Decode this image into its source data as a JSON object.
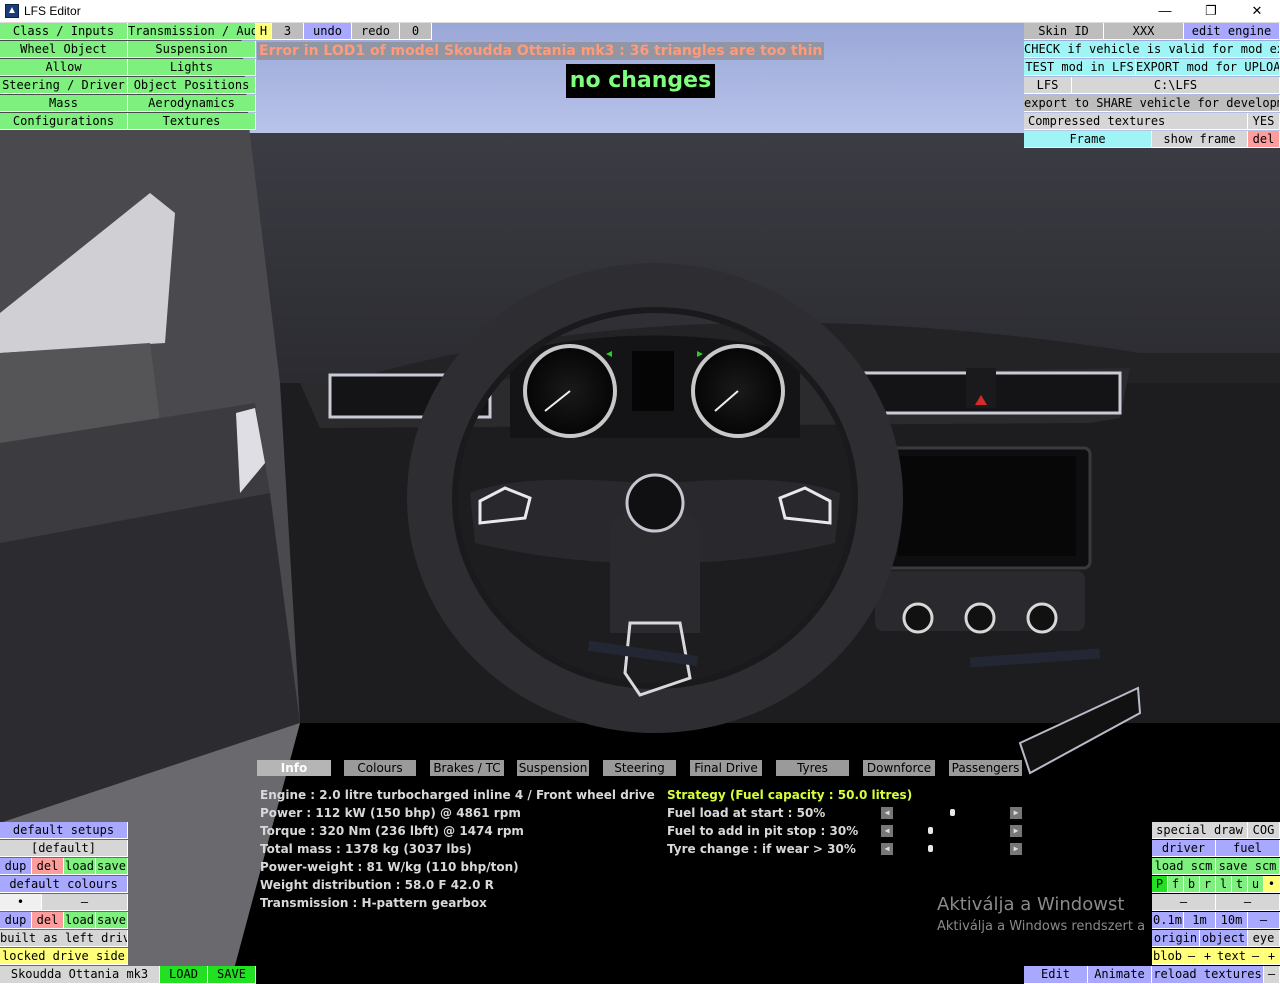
{
  "window": {
    "title": "LFS Editor",
    "minimize": "—",
    "maximize": "❐",
    "close": "✕"
  },
  "left_menu": {
    "col1": [
      "Class / Inputs",
      "Wheel Object",
      "Allow",
      "Steering / Driver",
      "Mass",
      "Configurations"
    ],
    "col2": [
      "Transmission / Audio",
      "Suspension",
      "Lights",
      "Object Positions",
      "Aerodynamics",
      "Textures"
    ]
  },
  "toolbar": {
    "h": "H",
    "count": "3",
    "undo": "undo",
    "redo": "redo",
    "redo_count": "0"
  },
  "messages": {
    "error": "Error in LOD1 of model Skoudda Ottania mk3 : 36 triangles are too thin",
    "status": "no changes"
  },
  "right_panel": {
    "skin_id": "Skin ID",
    "skin_value": "XXX",
    "edit_engine": "edit engine",
    "check": "CHECK if vehicle is valid for mod export",
    "test": "TEST mod in LFS",
    "export_upload": "EXPORT mod for UPLOAD",
    "lfs": "LFS",
    "path": "C:\\LFS",
    "export_share": "export to SHARE vehicle for development",
    "compressed": "Compressed textures",
    "compressed_value": "YES",
    "frame": "Frame",
    "show_frame": "show frame",
    "del": "del"
  },
  "tabs": [
    "Info",
    "Colours",
    "Brakes / TC",
    "Suspension",
    "Steering",
    "Final Drive",
    "Tyres",
    "Downforce",
    "Passengers"
  ],
  "info": {
    "engine": "Engine : 2.0 litre turbocharged inline 4 / Front wheel drive",
    "power": "Power : 112 kW (150 bhp) @ 4861 rpm",
    "torque": "Torque : 320 Nm (236 lbft) @ 1474 rpm",
    "mass": "Total mass : 1378 kg (3037 lbs)",
    "power_weight": "Power-weight : 81 W/kg (110 bhp/ton)",
    "weight_dist": "Weight distribution : 58.0 F  42.0 R",
    "transmission": "Transmission : H-pattern gearbox"
  },
  "strategy": {
    "title": "Strategy (Fuel capacity : 50.0 litres)",
    "fuel_load": "Fuel load at start : 50%",
    "fuel_pit": "Fuel to add in pit stop : 30%",
    "tyre_change": "Tyre change : if wear > 30%",
    "fuel_load_level": 0.5,
    "fuel_pit_level": 0.3,
    "tyre_change_level": 0.3
  },
  "bottom_left": {
    "default_setups": "default setups",
    "default": "[default]",
    "dup": "dup",
    "del": "del",
    "load": "load",
    "save": "save",
    "default_colours": "default colours",
    "dot": "•",
    "dash": "–",
    "built_left": "built as left drive",
    "locked": "locked drive side",
    "car_name": "Skoudda Ottania mk3",
    "load_btn": "LOAD",
    "save_btn": "SAVE"
  },
  "bottom_right": {
    "special_draw": "special draw",
    "cog": "COG",
    "driver": "driver",
    "fuel": "fuel",
    "load_scm": "load scm",
    "save_scm": "save scm",
    "letters": [
      "P",
      "f",
      "b",
      "r",
      "l",
      "t",
      "u",
      "•"
    ],
    "dash": "–",
    "d01": "0.1m",
    "d1": "1m",
    "d10": "10m",
    "minus": "–",
    "origin": "origin",
    "object": "object",
    "eye": "eye",
    "blob": "blob",
    "plus": "+",
    "text": "text",
    "edit": "Edit",
    "animate": "Animate",
    "reload": "reload textures"
  },
  "watermark": {
    "line1": "Aktiválja a Windowst",
    "line2": "Aktiválja a Windows rendszert a"
  },
  "colors": {
    "menu_green": "#7ef07e",
    "error_text": "#ff9a7a",
    "status_text": "#7dff7d",
    "strategy_text": "#d8ff3a"
  }
}
